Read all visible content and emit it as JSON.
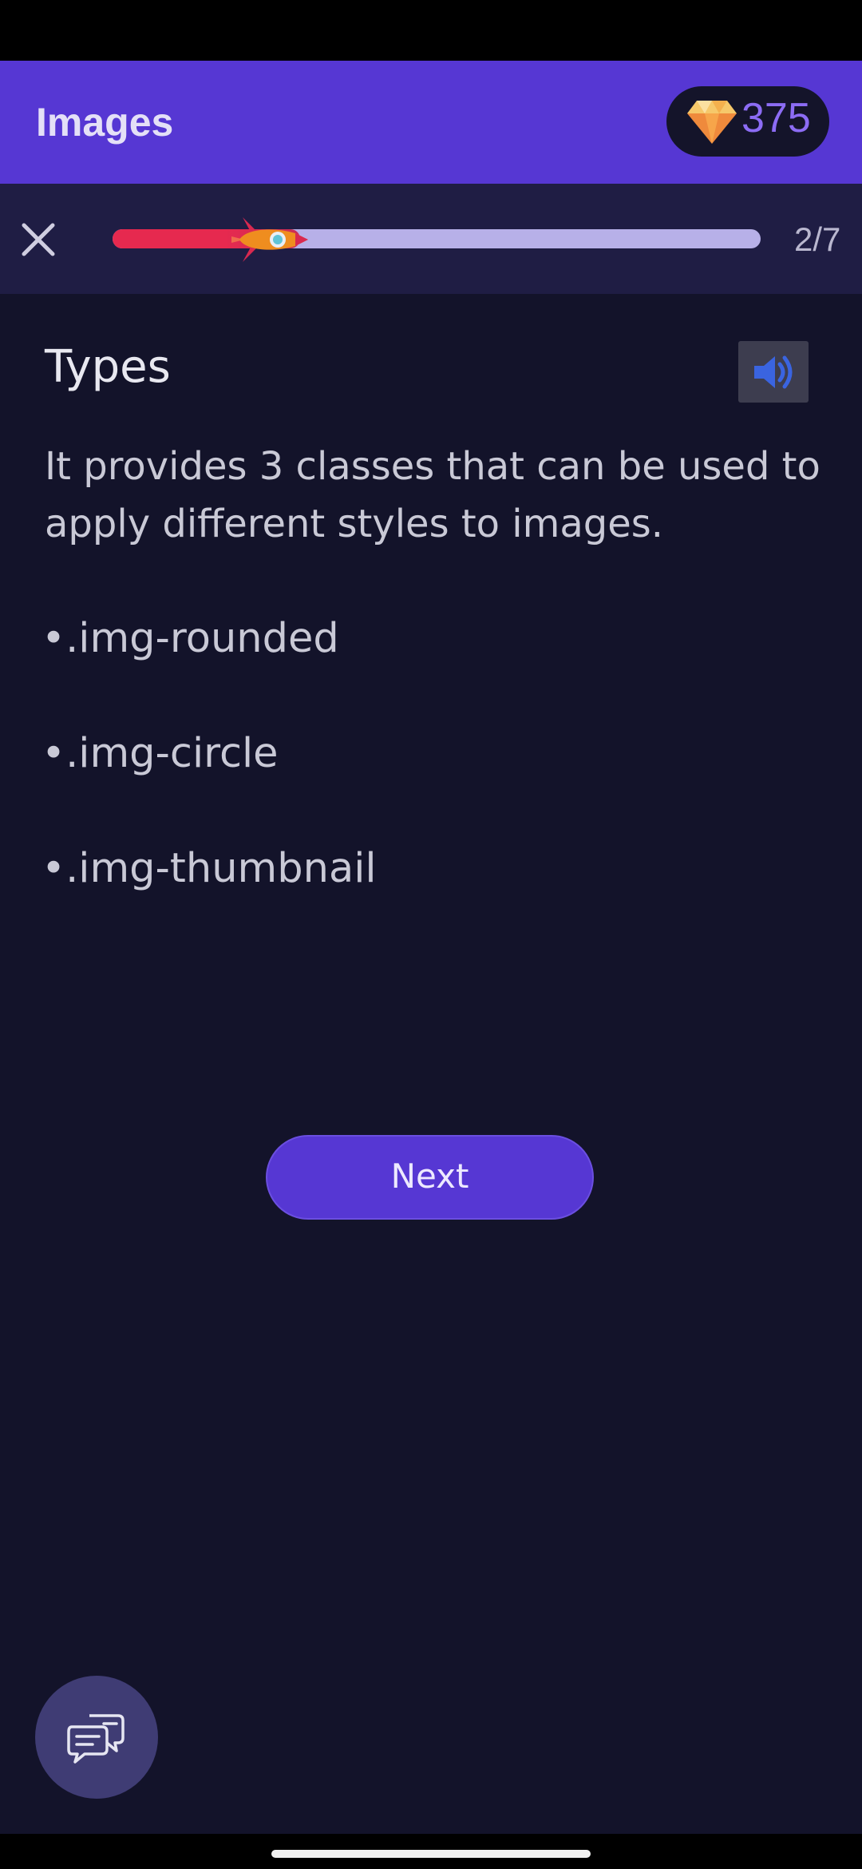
{
  "app_bar": {
    "title": "Images",
    "gems": "375",
    "gem_icon": "diamond-icon"
  },
  "progress": {
    "current": 2,
    "total": 7,
    "label": "2/7",
    "fraction": 0.29,
    "close_icon": "close-icon",
    "marker_icon": "rocket-icon"
  },
  "lesson": {
    "title": "Types",
    "sound_icon": "speaker-icon",
    "body": "It provides 3 classes that can be used to apply different styles to images.",
    "bullets": [
      "•.img-rounded",
      "•.img-circle",
      "•.img-thumbnail"
    ]
  },
  "actions": {
    "next_label": "Next",
    "chat_icon": "chat-bubbles-icon"
  },
  "colors": {
    "accent": "#5637d3",
    "background": "#13132a",
    "progress_fill": "#e6294f",
    "progress_track": "#b7b0e8",
    "gem_text": "#8c6cf4",
    "sound_icon": "#3a64e0"
  }
}
